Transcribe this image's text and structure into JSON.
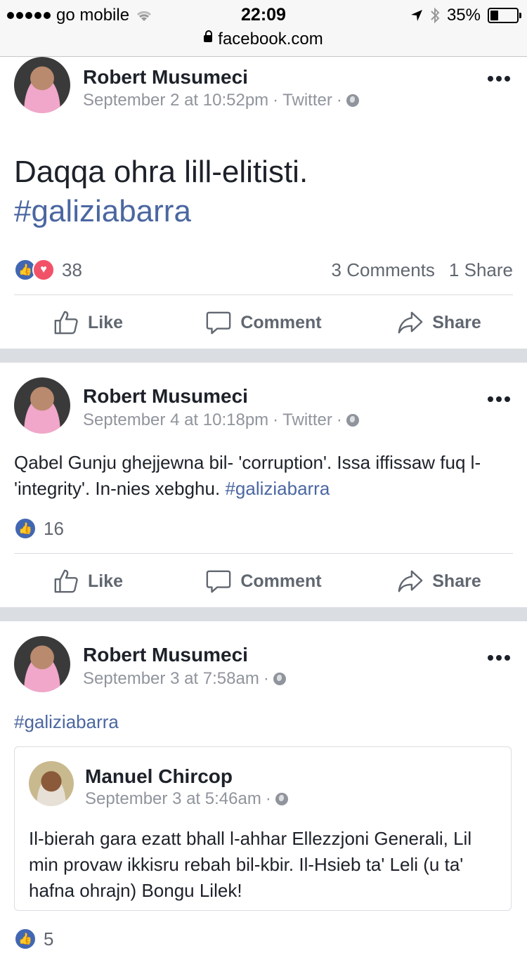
{
  "status_bar": {
    "carrier": "go mobile",
    "time": "22:09",
    "battery": "35%",
    "battery_level": 0.35,
    "url": "facebook.com"
  },
  "posts": [
    {
      "author": "Robert Musumeci",
      "date": "September 2 at 10:52pm",
      "source": "Twitter",
      "text": "Daqqa ohra lill-elitisti.",
      "hashtag": "#galiziabarra",
      "reaction_count": "38",
      "comments": "3 Comments",
      "shares": "1 Share"
    },
    {
      "author": "Robert Musumeci",
      "date": "September 4 at 10:18pm",
      "source": "Twitter",
      "text": "Qabel Gunju ghejjewna bil- 'corruption'. Issa iffissaw fuq l-'integrity'. In-nies xebghu.",
      "hashtag": "#galiziabarra",
      "reaction_count": "16"
    },
    {
      "author": "Robert Musumeci",
      "date": "September 3 at 7:58am",
      "hashtag": "#galiziabarra",
      "shared": {
        "author": "Manuel Chircop",
        "date": "September 3 at 5:46am",
        "text": "Il-bierah gara ezatt bhall l-ahhar Ellezzjoni Generali, Lil min provaw ikkisru rebah bil-kbir. Il-Hsieb ta' Leli (u ta' hafna ohrajn) Bongu Lilek!"
      },
      "reaction_count": "5"
    }
  ],
  "actions": {
    "like": "Like",
    "comment": "Comment",
    "share": "Share"
  },
  "separator": "·",
  "colors": {
    "link": "#4b67a1",
    "like_blue": "#4267b2",
    "love_red": "#f25268",
    "meta_gray": "#90949c"
  }
}
